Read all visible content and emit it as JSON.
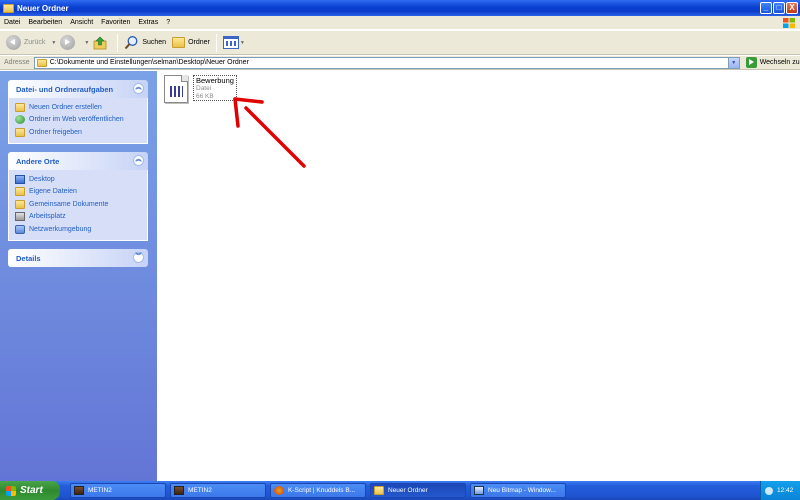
{
  "window": {
    "title": "Neuer Ordner",
    "controls": {
      "minimize": "_",
      "maximize": "□",
      "close": "X"
    }
  },
  "menu": {
    "items": [
      "Datei",
      "Bearbeiten",
      "Ansicht",
      "Favoriten",
      "Extras",
      "?"
    ]
  },
  "toolbar": {
    "back_label": "Zurück",
    "search_label": "Suchen",
    "folders_label": "Ordner"
  },
  "address": {
    "label": "Adresse",
    "value": "C:\\Dokumente und Einstellungen\\selman\\Desktop\\Neuer Ordner",
    "go_label": "Wechseln zu"
  },
  "sidebar": {
    "tasks": {
      "title": "Datei- und Ordneraufgaben",
      "items": [
        "Neuen Ordner erstellen",
        "Ordner im Web veröffentlichen",
        "Ordner freigeben"
      ]
    },
    "places": {
      "title": "Andere Orte",
      "items": [
        "Desktop",
        "Eigene Dateien",
        "Gemeinsame Dokumente",
        "Arbeitsplatz",
        "Netzwerkumgebung"
      ]
    },
    "details": {
      "title": "Details"
    }
  },
  "content": {
    "file": {
      "name": "Bewerbung",
      "type": "Datei",
      "size": "66 KB"
    }
  },
  "taskbar": {
    "start_label": "Start",
    "tasks": [
      "METIN2",
      "METIN2",
      "K-Script | Knuddels B...",
      "Neuer Ordner",
      "Neu Bitmap - Window..."
    ],
    "clock": "12:42"
  },
  "colors": {
    "titlebar": "#0a3fd0",
    "sidebar": "#6b8be0",
    "link": "#215dc6",
    "arrow": "#e00000"
  }
}
